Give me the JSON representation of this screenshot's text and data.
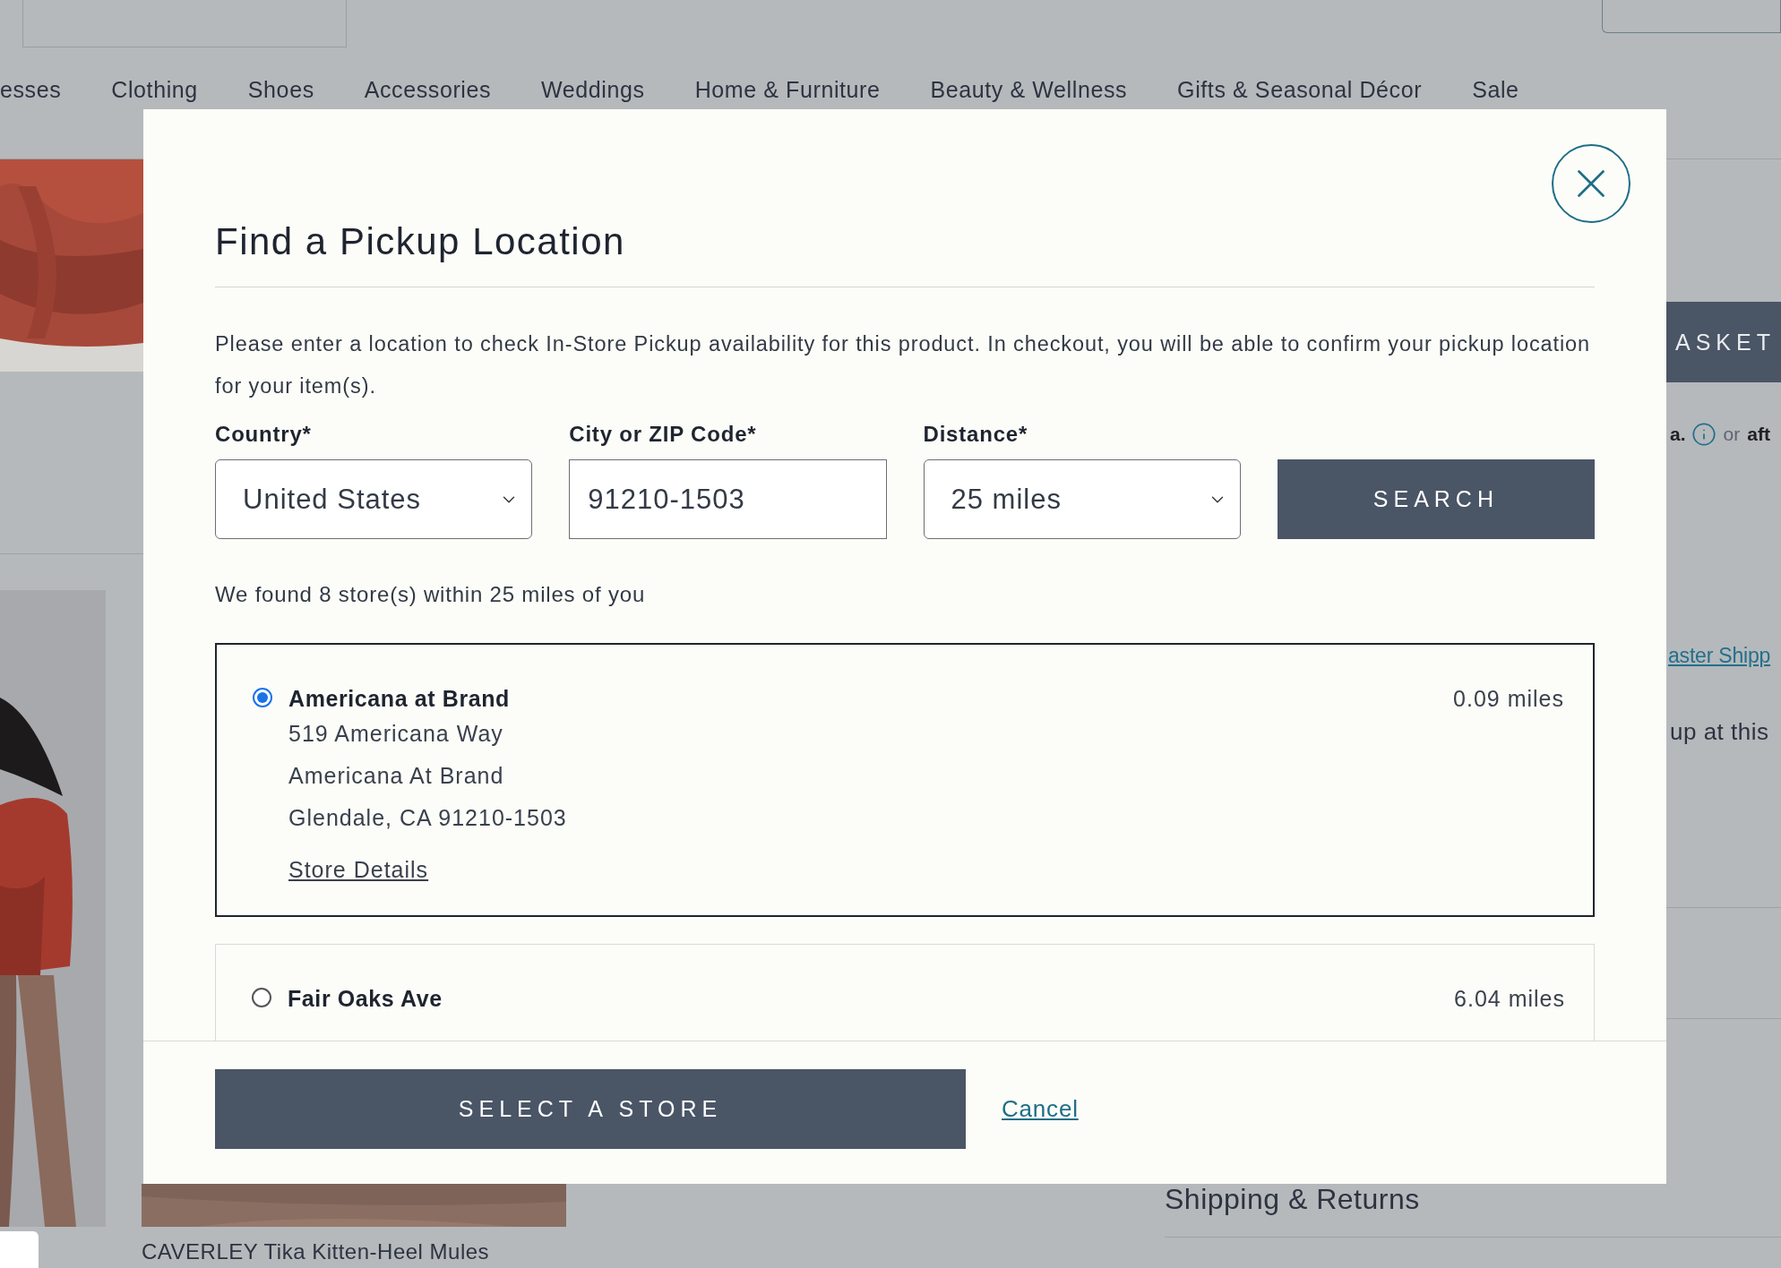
{
  "nav": [
    "esses",
    "Clothing",
    "Shoes",
    "Accessories",
    "Weddings",
    "Home & Furniture",
    "Beauty & Wellness",
    "Gifts & Seasonal Décor",
    "Sale"
  ],
  "product_side": {
    "basket_button": "ASKET",
    "payment_bold": "a.",
    "payment_or": "or",
    "payment_brand": "aft",
    "shipping_link": "aster Shipp",
    "pickup_note": "up at this",
    "shipping_heading": "Shipping & Returns"
  },
  "product_grid": {
    "caption": "CAVERLEY Tika Kitten-Heel Mules"
  },
  "modal": {
    "title": "Find a Pickup Location",
    "intro": "Please enter a location to check In-Store Pickup availability for this product. In checkout, you will be able to confirm your pickup location for your item(s).",
    "fields": [
      {
        "kind": "select",
        "label": "Country*",
        "value": "United States"
      },
      {
        "kind": "input",
        "label": "City or ZIP Code*",
        "value": "91210-1503"
      },
      {
        "kind": "select",
        "label": "Distance*",
        "value": "25 miles"
      }
    ],
    "search_button": "SEARCH",
    "result_text": "We found 8 store(s) within 25 miles of you",
    "stores": [
      {
        "name": "Americana at Brand",
        "address": [
          "519 Americana Way",
          "Americana At Brand",
          "Glendale, CA 91210-1503"
        ],
        "link": "Store Details",
        "distance": "0.09 miles",
        "selected": true
      },
      {
        "name": "Fair Oaks Ave",
        "distance": "6.04 miles",
        "selected": false
      }
    ],
    "select_button": "SELECT A STORE",
    "cancel_link": "Cancel"
  }
}
